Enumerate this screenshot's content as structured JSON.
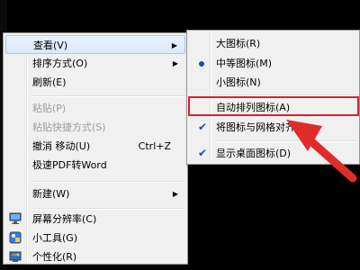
{
  "context_menu": {
    "items": [
      {
        "label": "查看(V)",
        "arrow": "▶"
      },
      {
        "label": "排序方式(O)",
        "arrow": "▶"
      },
      {
        "label": "刷新(E)"
      },
      {
        "label": "粘贴(P)",
        "disabled": true
      },
      {
        "label": "粘贴快捷方式(S)",
        "disabled": true
      },
      {
        "label": "撤消 移动(U)",
        "shortcut": "Ctrl+Z"
      },
      {
        "label": "极速PDF转Word"
      },
      {
        "label": "新建(W)",
        "arrow": "▶"
      },
      {
        "label": "屏幕分辨率(C)",
        "icon": "monitor-icon"
      },
      {
        "label": "小工具(G)",
        "icon": "gadgets-icon"
      },
      {
        "label": "个性化(R)",
        "icon": "personalize-icon"
      }
    ]
  },
  "view_submenu": {
    "items": [
      {
        "label": "大图标(R)"
      },
      {
        "label": "中等图标(M)",
        "radio": true
      },
      {
        "label": "小图标(N)"
      },
      {
        "label": "自动排列图标(A)",
        "highlighted": true
      },
      {
        "label": "将图标与网格对齐(I)",
        "checked": true
      },
      {
        "label": "显示桌面图标(D)",
        "checked": true
      }
    ]
  },
  "colors": {
    "annotation": "#d4232b",
    "check": "#1a4e9e"
  }
}
